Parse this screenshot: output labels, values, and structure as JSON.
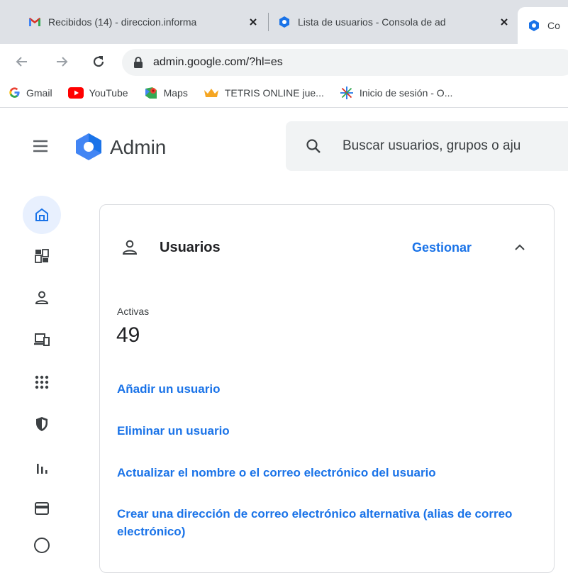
{
  "browser": {
    "tabs": [
      {
        "title": "Recibidos (14) - direccion.informa",
        "icon": "gmail-icon"
      },
      {
        "title": "Lista de usuarios - Consola de ad",
        "icon": "admin-console-icon"
      },
      {
        "title": "Co",
        "icon": "admin-console-icon"
      }
    ],
    "url": "admin.google.com/?hl=es"
  },
  "bookmarks": [
    {
      "label": "Gmail",
      "icon": "google-icon"
    },
    {
      "label": "YouTube",
      "icon": "youtube-icon"
    },
    {
      "label": "Maps",
      "icon": "maps-icon"
    },
    {
      "label": "TETRIS ONLINE jue...",
      "icon": "crown-icon"
    },
    {
      "label": "Inicio de sesión - O...",
      "icon": "sparkle-icon"
    }
  ],
  "header": {
    "brand": "Admin",
    "search_placeholder": "Buscar usuarios, grupos o aju"
  },
  "rail": [
    {
      "name": "home-icon"
    },
    {
      "name": "dashboard-icon"
    },
    {
      "name": "users-icon"
    },
    {
      "name": "devices-icon"
    },
    {
      "name": "apps-icon"
    },
    {
      "name": "security-icon"
    },
    {
      "name": "reports-icon"
    },
    {
      "name": "billing-icon"
    }
  ],
  "card": {
    "title": "Usuarios",
    "manage": "Gestionar",
    "stat_label": "Activas",
    "stat_value": "49",
    "links": [
      "Añadir un usuario",
      "Eliminar un usuario",
      "Actualizar el nombre o el correo electrónico del usuario",
      "Crear una dirección de correo electrónico alternativa (alias de correo electrónico)"
    ]
  },
  "colors": {
    "accent": "#1a73e8",
    "tabstrip": "#dee1e6",
    "rail_active": "#e8f0fe",
    "admin_logo": "#4285f4"
  }
}
